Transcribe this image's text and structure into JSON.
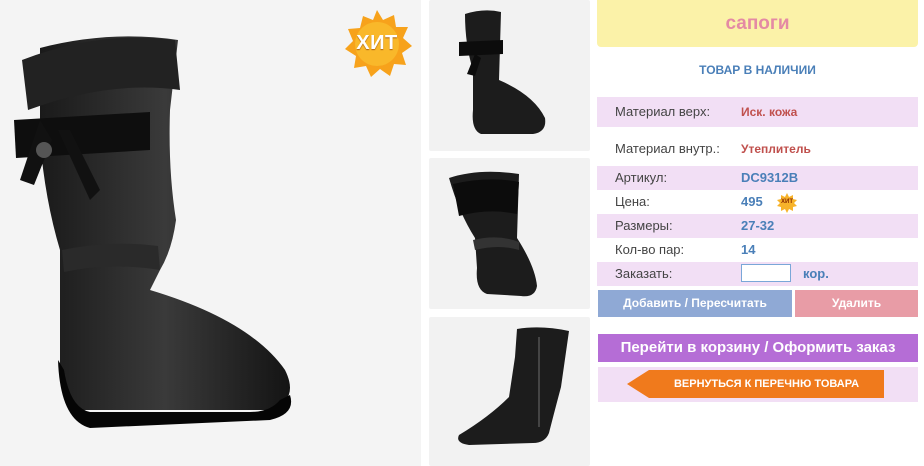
{
  "product": {
    "title": "сапоги",
    "stock_status": "ТОВАР В НАЛИЧИИ",
    "hit_badge": "ХИТ",
    "mini_hit_badge": "ХИТ"
  },
  "details": [
    {
      "label": "Материал верх:",
      "value": "Иск. кожа"
    },
    {
      "label": "Материал внутр.:",
      "value": "Утеплитель"
    },
    {
      "label": "Артикул:",
      "value": "DC9312B"
    },
    {
      "label": "Цена:",
      "value": "495"
    },
    {
      "label": "Размеры:",
      "value": "27-32"
    },
    {
      "label": "Кол-во пар:",
      "value": "14"
    }
  ],
  "order": {
    "label": "Заказать:",
    "quantity_value": "",
    "unit": "кор."
  },
  "buttons": {
    "add": "Добавить / Пересчитать",
    "delete": "Удалить",
    "cart": "Перейти в корзину / Оформить заказ",
    "back": "ВЕРНУТЬСЯ К ПЕРЕЧНЮ ТОВАРА"
  },
  "colors": {
    "title_bg": "#fbf2a8",
    "title_text": "#e48aa4",
    "row_highlight": "#f2dff5",
    "accent_blue": "#4a7fb8",
    "accent_red": "#c0504d",
    "add_button": "#8fa9d5",
    "delete_button": "#e89ca6",
    "cart_button": "#b56dd6",
    "back_button": "#f07a1c"
  },
  "icons": {
    "hit": "starburst-badge-icon",
    "back_arrow": "arrow-left-icon"
  }
}
